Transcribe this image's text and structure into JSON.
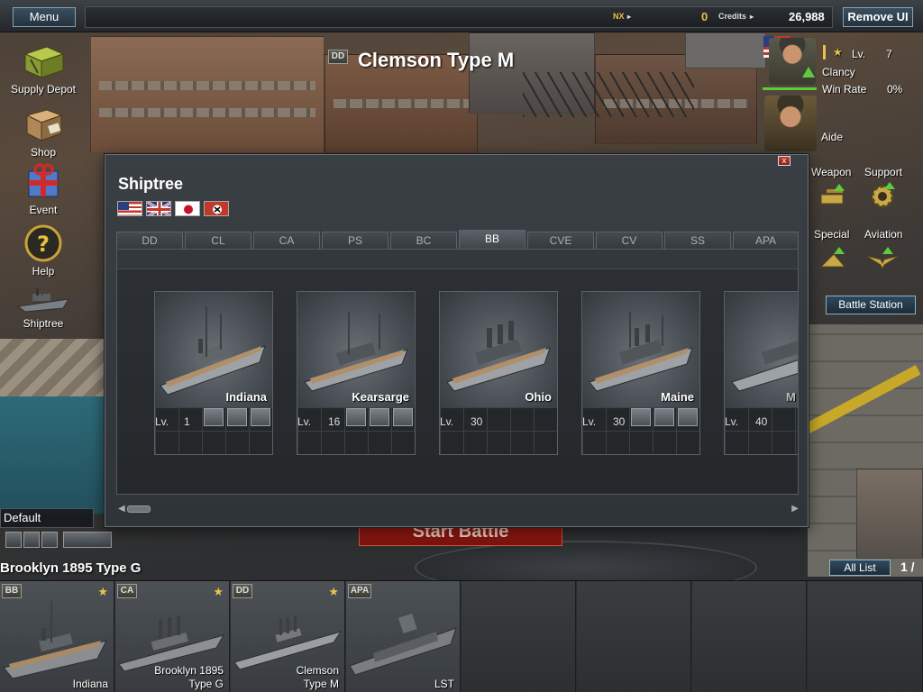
{
  "topbar": {
    "menu_label": "Menu",
    "nx_label": "NX",
    "nx_value": "0",
    "credits_label": "Credits",
    "credits_value": "26,988",
    "remove_ui_label": "Remove UI"
  },
  "header": {
    "type_badge": "DD",
    "ship_name": "Clemson Type M"
  },
  "left_menu": [
    {
      "label": "Supply Depot",
      "icon": "supply-crate-icon"
    },
    {
      "label": "Shop",
      "icon": "shop-box-icon"
    },
    {
      "label": "Event",
      "icon": "gift-icon"
    },
    {
      "label": "Help",
      "icon": "help-icon"
    },
    {
      "label": "Shiptree",
      "icon": "shiptree-ship-icon"
    }
  ],
  "player": {
    "lv_label": "Lv.",
    "level": "7",
    "name": "Clancy",
    "win_rate_label": "Win Rate",
    "win_rate": "0%",
    "aide_label": "Aide"
  },
  "upgrades": [
    {
      "label": "Weapon",
      "icon": "weapon-upgrade-icon"
    },
    {
      "label": "Support",
      "icon": "support-gear-icon"
    },
    {
      "label": "Special",
      "icon": "special-upgrade-icon"
    },
    {
      "label": "Aviation",
      "icon": "aviation-wings-icon"
    }
  ],
  "battle_station_label": "Battle Station",
  "shiptree": {
    "title": "Shiptree",
    "close_glyph": "x",
    "nations": [
      "usa-flag",
      "uk-flag",
      "japan-flag",
      "germany-flag"
    ],
    "tabs": [
      "DD",
      "CL",
      "CA",
      "PS",
      "BC",
      "BB",
      "CVE",
      "CV",
      "SS",
      "APA"
    ],
    "active_tab": "BB",
    "ships": [
      {
        "name": "Indiana",
        "lv_label": "Lv.",
        "level": "1",
        "equipment": 3
      },
      {
        "name": "Kearsarge",
        "lv_label": "Lv.",
        "level": "16",
        "equipment": 3
      },
      {
        "name": "Ohio",
        "lv_label": "Lv.",
        "level": "30",
        "equipment": 0
      },
      {
        "name": "Maine",
        "lv_label": "Lv.",
        "level": "30",
        "equipment": 3
      },
      {
        "name": "M",
        "lv_label": "Lv.",
        "level": "40",
        "equipment": 0
      }
    ]
  },
  "start_battle_label": "Start Battle",
  "fleet_preset": "Default",
  "fleet_title": "Brooklyn 1895 Type G",
  "all_list_label": "All List",
  "page_indicator": "1 /",
  "fleet": [
    {
      "badge": "BB",
      "name_line1": "Indiana",
      "name_line2": "",
      "starred": true
    },
    {
      "badge": "CA",
      "name_line1": "Brooklyn 1895",
      "name_line2": "Type G",
      "starred": true
    },
    {
      "badge": "DD",
      "name_line1": "Clemson",
      "name_line2": "Type M",
      "starred": true
    },
    {
      "badge": "APA",
      "name_line1": "",
      "name_line2": "LST",
      "starred": false
    }
  ],
  "colors": {
    "accent_blue": "#8fb0c4",
    "start_battle_red": "#b01e14",
    "gold_text": "#e8c24a",
    "upgrade_green": "#5ccc3c"
  }
}
